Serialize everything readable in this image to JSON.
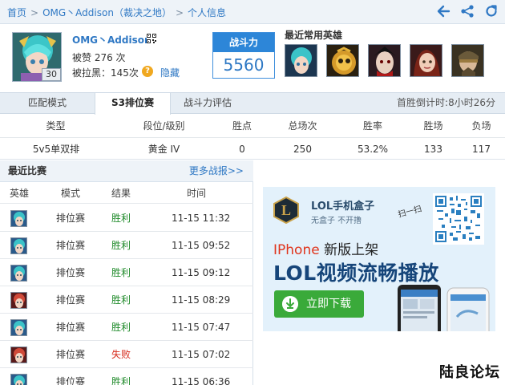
{
  "breadcrumb": {
    "home": "首页",
    "sep": ">",
    "team": "OMG丶Addison（裁决之地）",
    "current": "个人信息"
  },
  "toolbar": {
    "icons": [
      "back-arrow-icon",
      "share-icon",
      "refresh-icon"
    ]
  },
  "profile": {
    "name": "OMG丶Addison",
    "level": "30",
    "likes": "被赞 276 次",
    "blacklisted": "被拉黑：145次",
    "help_icon": "?",
    "hide_label": "隐藏"
  },
  "power": {
    "label": "战斗力",
    "value": "5560"
  },
  "favorite_heroes": {
    "title": "最近常用英雄",
    "heroes": [
      "hero-portrait-1",
      "hero-portrait-2",
      "hero-portrait-3",
      "hero-portrait-4",
      "hero-portrait-5"
    ]
  },
  "tabs": [
    {
      "label": "匹配模式",
      "active": false
    },
    {
      "label": "S3排位赛",
      "active": true
    },
    {
      "label": "战斗力评估",
      "active": false
    }
  ],
  "countdown": "首胜倒计时:8小时26分",
  "stats": {
    "headers": [
      "类型",
      "段位/级别",
      "胜点",
      "总场次",
      "胜率",
      "胜场",
      "负场"
    ],
    "row": [
      "5v5单双排",
      "黄金 IV",
      "0",
      "250",
      "53.2%",
      "133",
      "117"
    ]
  },
  "recent": {
    "title": "最近比赛",
    "more": "更多战报>>",
    "headers": [
      "英雄",
      "模式",
      "结果",
      "时间"
    ],
    "rows": [
      {
        "mode": "排位赛",
        "result": "胜利",
        "time": "11-15 11:32"
      },
      {
        "mode": "排位赛",
        "result": "胜利",
        "time": "11-15 09:52"
      },
      {
        "mode": "排位赛",
        "result": "胜利",
        "time": "11-15 09:12"
      },
      {
        "mode": "排位赛",
        "result": "胜利",
        "time": "11-15 08:29"
      },
      {
        "mode": "排位赛",
        "result": "胜利",
        "time": "11-15 07:47"
      },
      {
        "mode": "排位赛",
        "result": "失败",
        "time": "11-15 07:02"
      },
      {
        "mode": "排位赛",
        "result": "胜利",
        "time": "11-15 06:36"
      }
    ]
  },
  "ad": {
    "title": "LOL手机盒子",
    "subtitle": "无盒子 不开撸",
    "scan": "扫一扫",
    "headline_red": "IPhone",
    "headline_rest": " 新版上架",
    "slogan": "LOL视频流畅播放",
    "button": "立即下载"
  },
  "watermark": "陆良论坛",
  "colors": {
    "accent": "#2f78c4",
    "win": "#1f8a2a",
    "lose": "#d62a1a",
    "button": "#3aaa3a"
  }
}
